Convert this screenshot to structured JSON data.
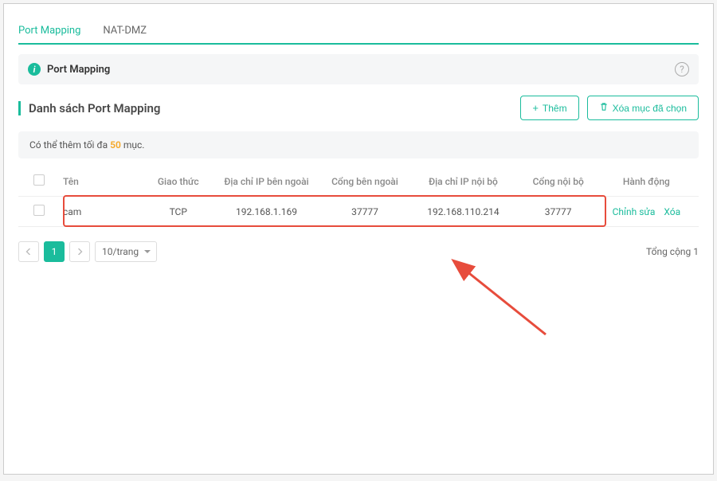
{
  "tabs": {
    "t1": "Port Mapping",
    "t2": "NAT-DMZ"
  },
  "banner": {
    "title": "Port Mapping"
  },
  "heading": "Danh sách Port Mapping",
  "buttons": {
    "add": "Thêm",
    "delete_selected": "Xóa mục đã chọn"
  },
  "max_note": {
    "prefix": "Có thể thêm tối đa ",
    "count": "50",
    "suffix": " mục."
  },
  "columns": {
    "name": "Tên",
    "protocol": "Giao thức",
    "ext_ip": "Địa chỉ IP bên ngoài",
    "ext_port": "Cổng bên ngoài",
    "int_ip": "Địa chỉ IP nội bộ",
    "int_port": "Cổng nội bộ",
    "actions": "Hành động"
  },
  "rows": [
    {
      "name": "cam",
      "protocol": "TCP",
      "ext_ip": "192.168.1.169",
      "ext_port": "37777",
      "int_ip": "192.168.110.214",
      "int_port": "37777"
    }
  ],
  "row_actions": {
    "edit": "Chỉnh sửa",
    "delete": "Xóa"
  },
  "pagination": {
    "current": "1",
    "per_page": "10/trang",
    "total_label": "Tổng cộng 1"
  }
}
